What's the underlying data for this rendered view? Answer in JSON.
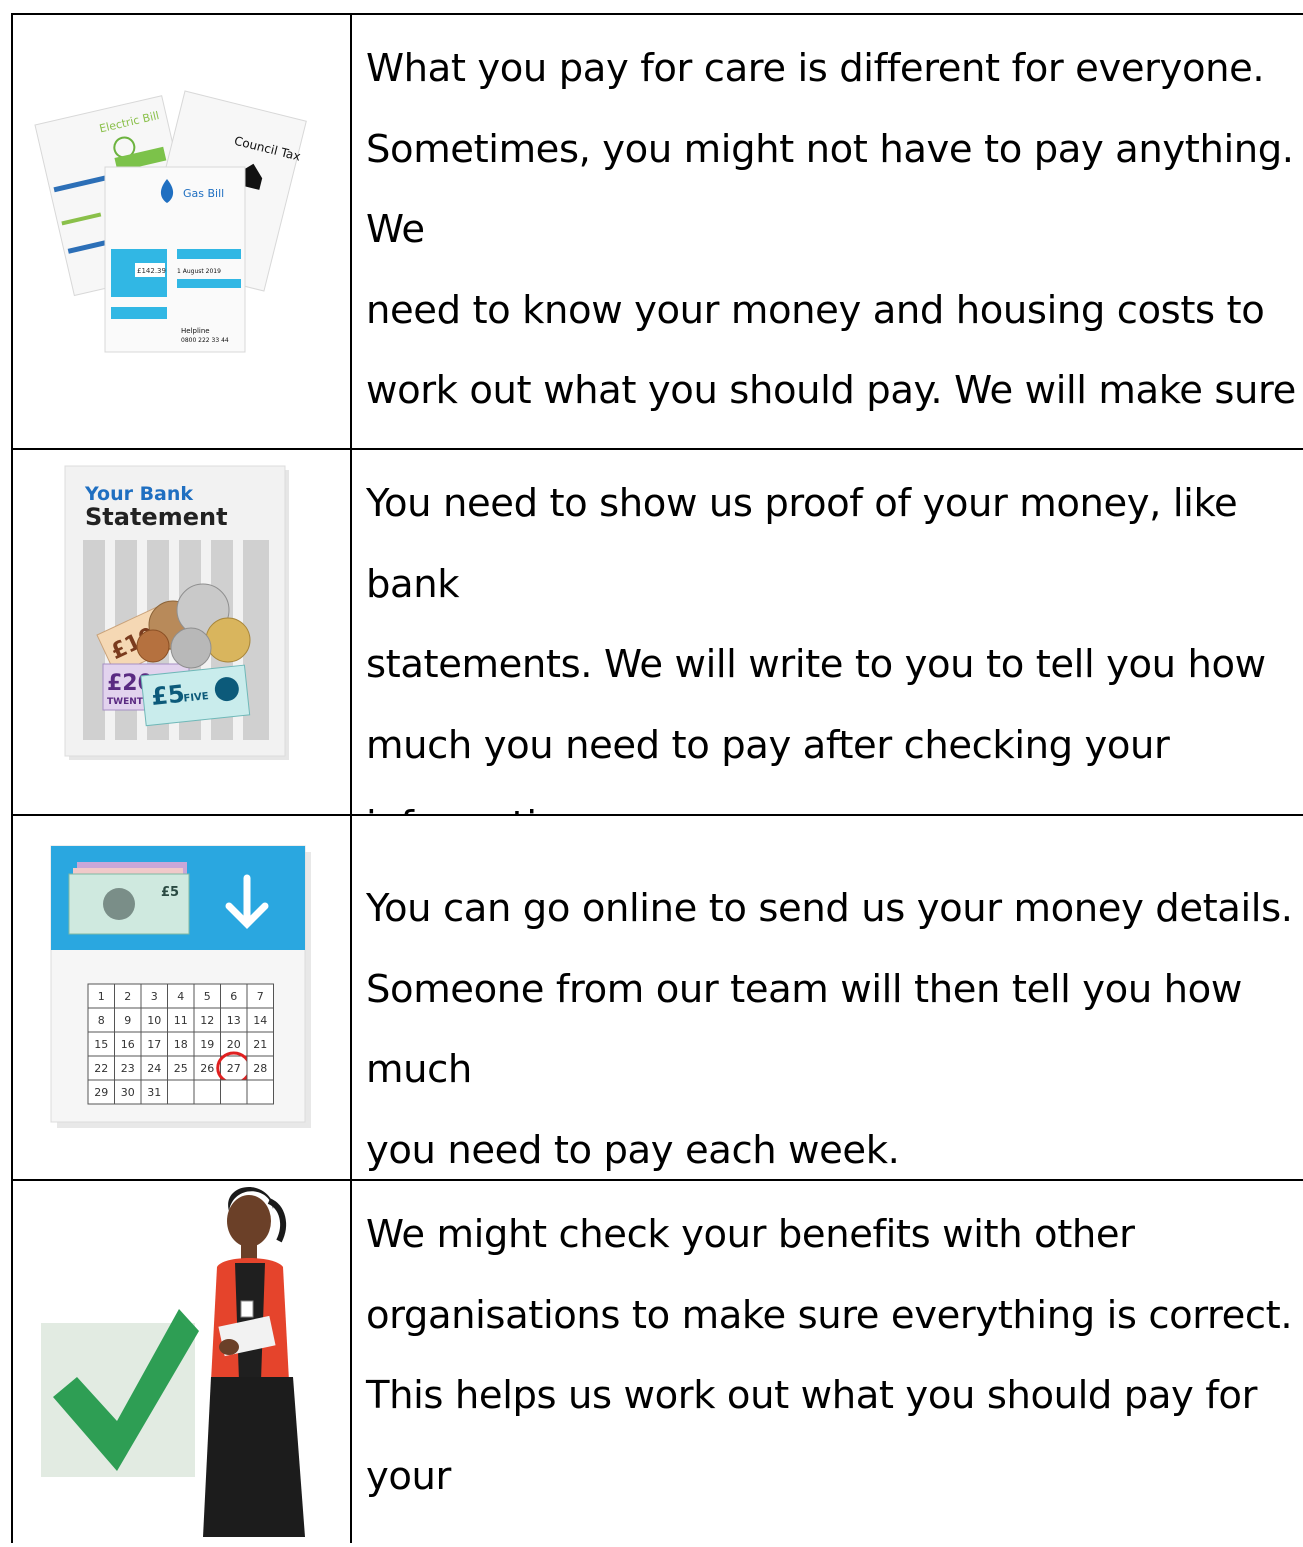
{
  "rows": [
    {
      "text": "What you pay for care is different for everyone.\nSometimes, you might not have to pay anything. We\nneed to know your money and housing costs to\nwork out what you should pay. We will make sure\nyou keep enough money to live on",
      "image": {
        "icon": "bills-icon",
        "labels": {
          "electric": "Electric Bill",
          "council": "Council Tax",
          "gas": "Gas Bill",
          "amount": "£142.39",
          "helpline": "Helpline",
          "helpline_number": "0800 222 33 44",
          "due": "1 August 2019"
        }
      }
    },
    {
      "text": "You need to show us proof of your money, like bank\nstatements. We will write to you to tell you how\nmuch you need to pay after checking your\ninformation.",
      "image": {
        "icon": "bank-statement-icon",
        "labels": {
          "line1": "Your Bank",
          "line2": "Statement",
          "note1": "£10",
          "note2": "£20",
          "note3": "£5",
          "note3_word": "FIVE",
          "note2_word": "TWENTY"
        }
      }
    },
    {
      "text": "You can go online to send us your money details.\nSomeone from our team will then tell you how much\nyou need to pay each week.",
      "image": {
        "icon": "calendar-payment-icon",
        "labels": {
          "note": "£5"
        },
        "days": [
          "1",
          "2",
          "3",
          "4",
          "5",
          "6",
          "7",
          "8",
          "9",
          "10",
          "11",
          "12",
          "13",
          "14",
          "15",
          "16",
          "17",
          "18",
          "19",
          "20",
          "21",
          "22",
          "23",
          "24",
          "25",
          "26",
          "27",
          "28",
          "29",
          "30",
          "31"
        ],
        "circled_day": "27"
      }
    },
    {
      "text": "We might check your benefits with other\norganisations to make sure everything is correct.\nThis helps us work out what you should pay for your\ncare.",
      "image": {
        "icon": "checkmark-person-icon"
      }
    }
  ],
  "colors": {
    "accent_blue": "#2aa7e0",
    "check_green": "#2e9e54",
    "jacket_red": "#e5442c"
  }
}
